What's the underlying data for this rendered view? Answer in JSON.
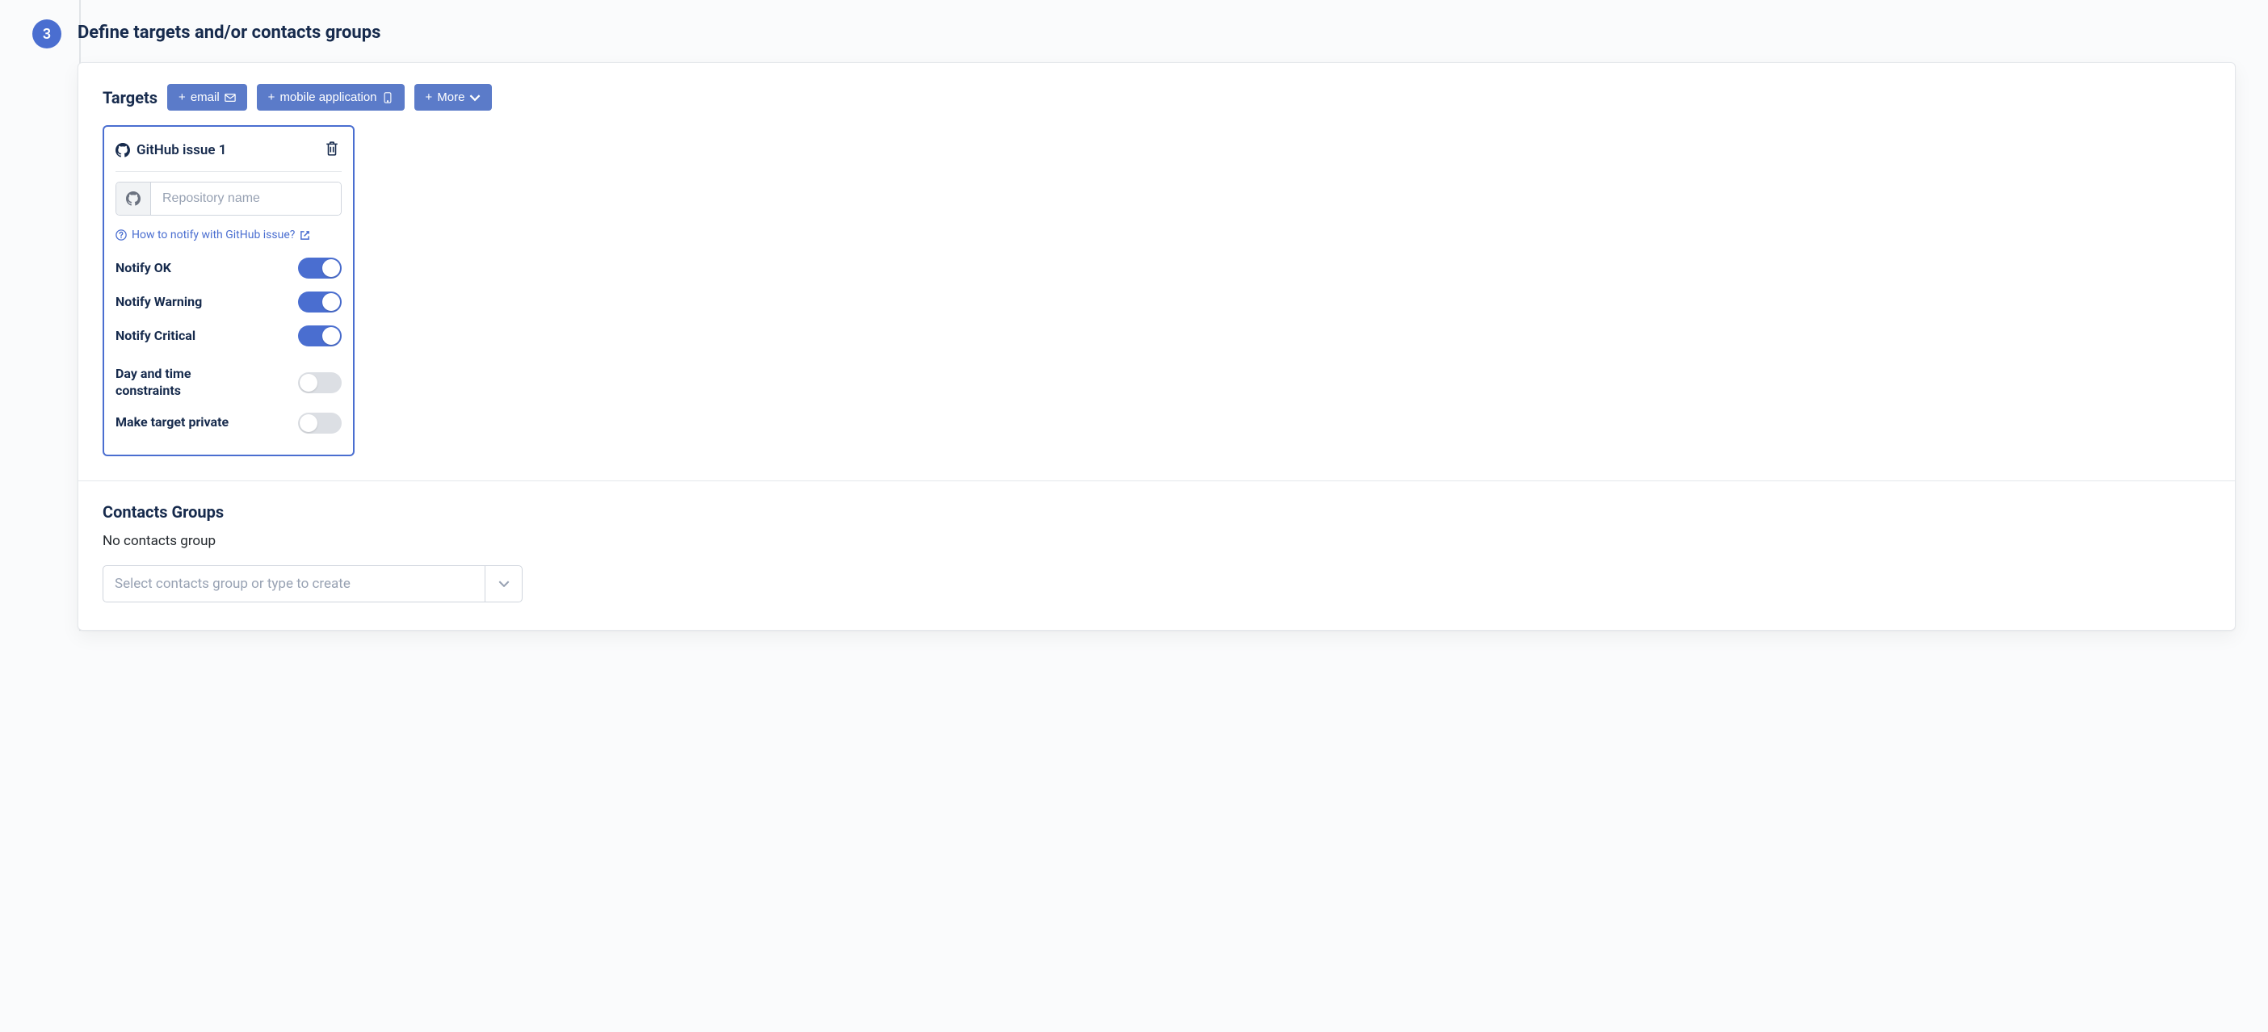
{
  "step": {
    "number": "3",
    "title": "Define targets and/or contacts groups"
  },
  "targets": {
    "section_title": "Targets",
    "buttons": {
      "email": "email",
      "mobile": "mobile application",
      "more": "More"
    },
    "card": {
      "title": "GitHub issue 1",
      "repo_placeholder": "Repository name",
      "help_text": "How to notify with GitHub issue?",
      "toggles": {
        "notify_ok": "Notify OK",
        "notify_warning": "Notify Warning",
        "notify_critical": "Notify Critical",
        "day_time": "Day and time constraints",
        "private": "Make target private"
      }
    }
  },
  "contacts": {
    "section_title": "Contacts Groups",
    "empty": "No contacts group",
    "placeholder": "Select contacts group or type to create"
  }
}
